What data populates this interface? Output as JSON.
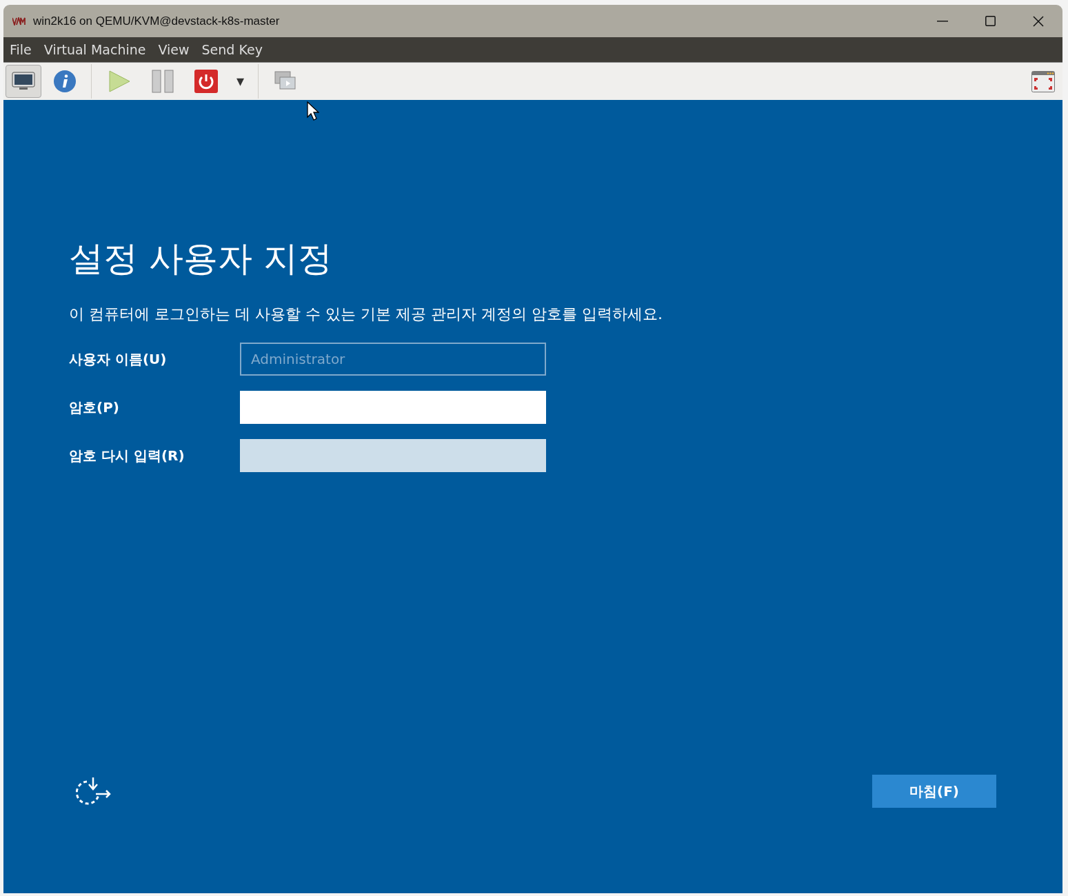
{
  "window": {
    "title": "win2k16 on QEMU/KVM@devstack-k8s-master"
  },
  "menu": [
    "File",
    "Virtual Machine",
    "View",
    "Send Key"
  ],
  "toolbar": [
    {
      "kind": "display",
      "selected": true
    },
    {
      "kind": "info",
      "selected": false
    }
  ],
  "dropdown": {
    "label": "▾"
  },
  "setup": {
    "heading": "설정 사용자 지정",
    "description": "이 컴퓨터에 로그인하는 데 사용할 수 있는 기본 제공 관리자 계정의 암호를 입력하세요.",
    "fields": [
      {
        "label": "사용자 이름(U)",
        "value": "Administrator",
        "disabled": true,
        "focused": false
      },
      {
        "label": "암호(P)",
        "disabled": false,
        "focused": true
      },
      {
        "label": "암호 다시 입력(R)",
        "disabled": false,
        "focused": false
      }
    ],
    "finish_button": "마침(F)"
  }
}
